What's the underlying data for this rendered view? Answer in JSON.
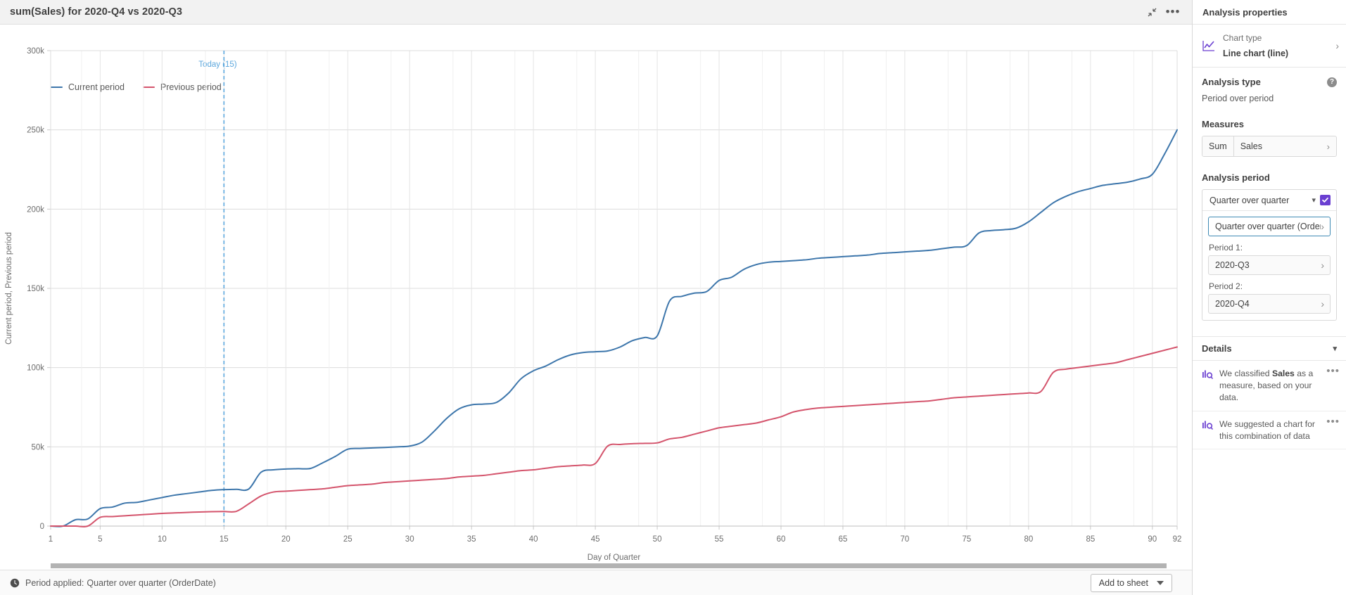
{
  "chart_header": {
    "title": "sum(Sales) for 2020-Q4 vs 2020-Q3",
    "minimize_icon": "minimize-icon",
    "more_icon": "ellipsis-icon"
  },
  "footer": {
    "clock_icon": "clock-icon",
    "label": "Period applied:",
    "value": "Quarter over quarter (OrderDate)",
    "add_to_sheet": "Add to sheet"
  },
  "properties": {
    "title": "Analysis properties",
    "chart_type": {
      "label": "Chart type",
      "value": "Line chart (line)",
      "icon": "line-chart-icon"
    },
    "analysis_type": {
      "heading": "Analysis type",
      "value": "Period over period",
      "help_icon": "help-icon"
    },
    "measures": {
      "heading": "Measures",
      "aggregation": "Sum",
      "field": "Sales"
    },
    "analysis_period": {
      "heading": "Analysis period",
      "selected": "Quarter over quarter",
      "checkbox_checked": true,
      "calendar_button": "Quarter over quarter (Order…",
      "period1_label": "Period 1:",
      "period1_value": "2020-Q3",
      "period2_label": "Period 2:",
      "period2_value": "2020-Q4"
    },
    "details": {
      "heading": "Details",
      "items": [
        {
          "icon": "insight-icon",
          "text_before": "We classified ",
          "bold": "Sales",
          "text_after": " as a measure, based on your data."
        },
        {
          "icon": "insight-icon",
          "text_before": "We suggested a chart for this combination of data",
          "bold": "",
          "text_after": ""
        }
      ]
    }
  },
  "chart_data": {
    "type": "line",
    "title": "sum(Sales) for 2020-Q4 vs 2020-Q3",
    "xlabel": "Day of Quarter",
    "ylabel": "Current period, Previous period",
    "xlim": [
      1,
      92
    ],
    "ylim": [
      0,
      300000
    ],
    "yticks": [
      0,
      50000,
      100000,
      150000,
      200000,
      250000,
      300000
    ],
    "ytick_labels": [
      "0",
      "50k",
      "100k",
      "150k",
      "200k",
      "250k",
      "300k"
    ],
    "xticks": [
      1,
      5,
      10,
      15,
      20,
      25,
      30,
      35,
      40,
      45,
      50,
      55,
      60,
      65,
      70,
      75,
      80,
      85,
      90,
      92
    ],
    "grid": true,
    "legend_position": "top-left",
    "annotation": {
      "text": "Today (15)",
      "x": 15,
      "color": "#5ca7dd",
      "style": "dashed-vertical-line"
    },
    "colors": {
      "current": "#3d76ab",
      "previous": "#d4546c"
    },
    "series": [
      {
        "name": "Current period",
        "color": "#3d76ab",
        "x": [
          1,
          2,
          3,
          4,
          5,
          6,
          7,
          8,
          9,
          10,
          11,
          12,
          13,
          14,
          15,
          16,
          17,
          18,
          19,
          20,
          21,
          22,
          23,
          24,
          25,
          26,
          27,
          28,
          29,
          30,
          31,
          32,
          33,
          34,
          35,
          36,
          37,
          38,
          39,
          40,
          41,
          42,
          43,
          44,
          45,
          46,
          47,
          48,
          49,
          50,
          51,
          52,
          53,
          54,
          55,
          56,
          57,
          58,
          59,
          60,
          61,
          62,
          63,
          64,
          65,
          66,
          67,
          68,
          69,
          70,
          71,
          72,
          73,
          74,
          75,
          76,
          77,
          78,
          79,
          80,
          81,
          82,
          83,
          84,
          85,
          86,
          87,
          88,
          89,
          90,
          91,
          92
        ],
        "values": [
          0,
          0,
          4000,
          4500,
          11000,
          12000,
          14500,
          15000,
          16500,
          18000,
          19500,
          20500,
          21500,
          22500,
          23000,
          23200,
          23400,
          34000,
          35500,
          36000,
          36200,
          36400,
          40000,
          44000,
          48500,
          49000,
          49300,
          49600,
          50000,
          50500,
          53000,
          60000,
          68000,
          74000,
          76500,
          77000,
          78000,
          84000,
          93000,
          98000,
          101000,
          105000,
          108000,
          109500,
          110000,
          110500,
          113000,
          117000,
          119000,
          120000,
          142000,
          145000,
          147000,
          148000,
          155000,
          157000,
          162000,
          165000,
          166500,
          167000,
          167500,
          168000,
          169000,
          169500,
          170000,
          170500,
          171000,
          172000,
          172500,
          173000,
          173500,
          174000,
          175000,
          176000,
          177000,
          185000,
          186500,
          187000,
          188000,
          192000,
          198000,
          204000,
          208000,
          211000,
          213000,
          215000,
          216000,
          217000,
          219000,
          222000,
          235000,
          250000
        ]
      },
      {
        "name": "Previous period",
        "color": "#d4546c",
        "x": [
          1,
          2,
          3,
          4,
          5,
          6,
          7,
          8,
          9,
          10,
          11,
          12,
          13,
          14,
          15,
          16,
          17,
          18,
          19,
          20,
          21,
          22,
          23,
          24,
          25,
          26,
          27,
          28,
          29,
          30,
          31,
          32,
          33,
          34,
          35,
          36,
          37,
          38,
          39,
          40,
          41,
          42,
          43,
          44,
          45,
          46,
          47,
          48,
          49,
          50,
          51,
          52,
          53,
          54,
          55,
          56,
          57,
          58,
          59,
          60,
          61,
          62,
          63,
          64,
          65,
          66,
          67,
          68,
          69,
          70,
          71,
          72,
          73,
          74,
          75,
          76,
          77,
          78,
          79,
          80,
          81,
          82,
          83,
          84,
          85,
          86,
          87,
          88,
          89,
          90,
          91,
          92
        ],
        "values": [
          0,
          0,
          0,
          0,
          5500,
          6000,
          6500,
          7000,
          7500,
          8000,
          8300,
          8600,
          8900,
          9100,
          9200,
          9300,
          14000,
          19000,
          21500,
          22000,
          22500,
          23000,
          23500,
          24500,
          25500,
          26000,
          26500,
          27500,
          28000,
          28500,
          29000,
          29500,
          30000,
          31000,
          31500,
          32000,
          33000,
          34000,
          35000,
          35500,
          36500,
          37500,
          38000,
          38500,
          39500,
          50500,
          51500,
          52000,
          52200,
          52500,
          55000,
          56000,
          58000,
          60000,
          62000,
          63000,
          64000,
          65000,
          67000,
          69000,
          72000,
          73500,
          74500,
          75000,
          75500,
          76000,
          76500,
          77000,
          77500,
          78000,
          78500,
          79000,
          80000,
          81000,
          81500,
          82000,
          82500,
          83000,
          83500,
          84000,
          85000,
          97000,
          99000,
          100000,
          101000,
          102000,
          103000,
          105000,
          107000,
          109000,
          111000,
          113000
        ]
      }
    ]
  }
}
